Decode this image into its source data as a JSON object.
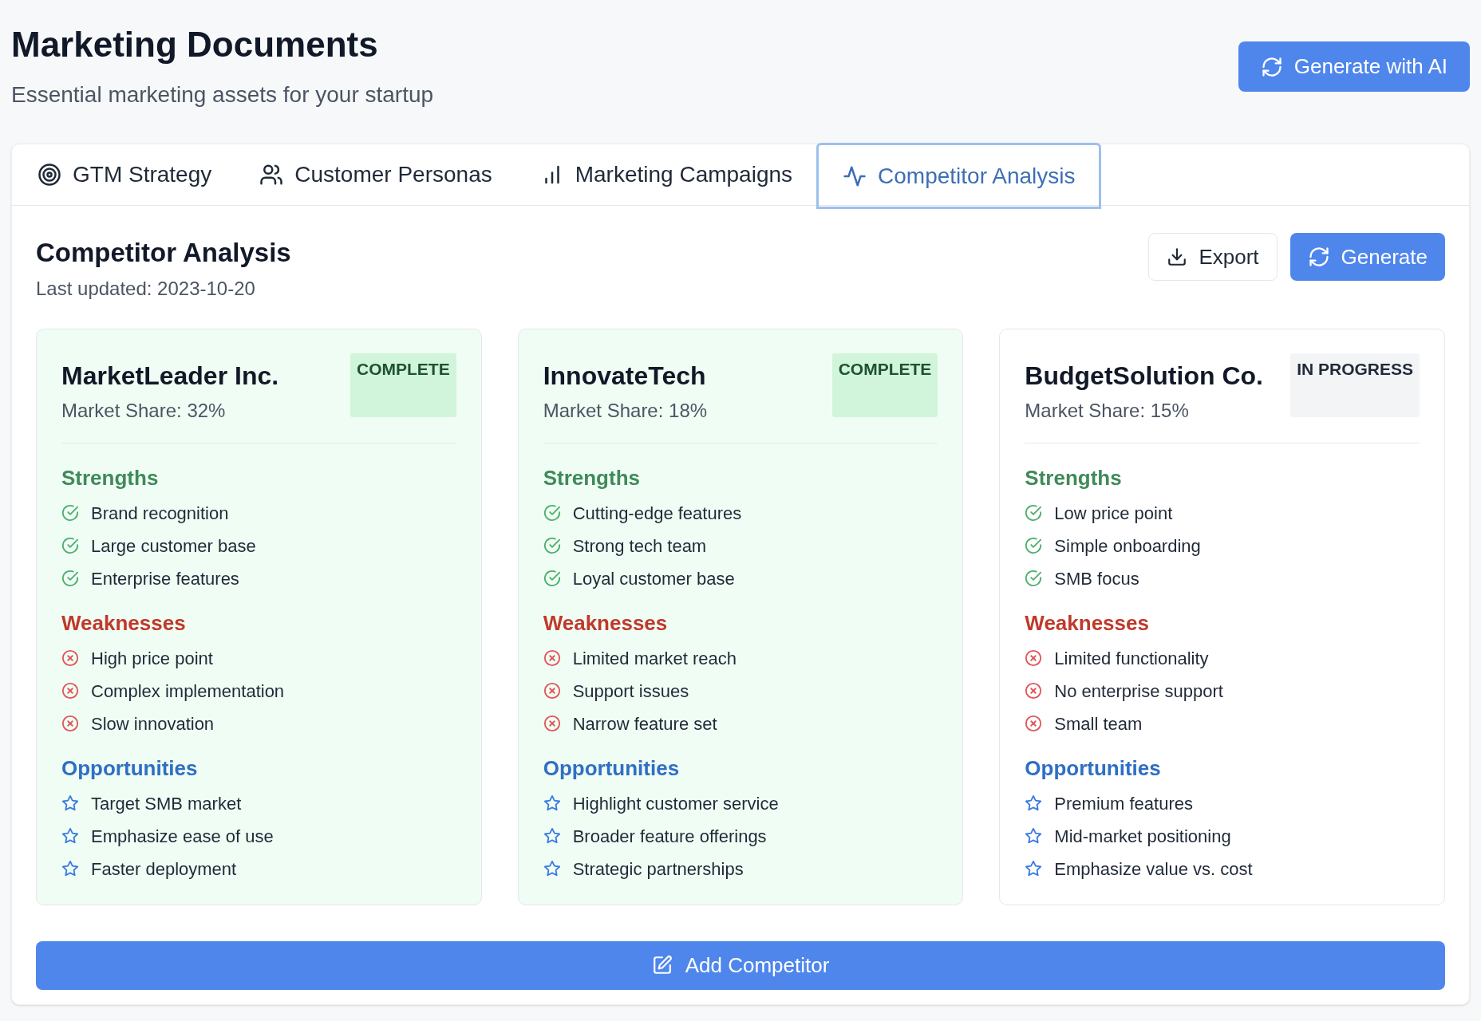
{
  "header": {
    "title": "Marketing Documents",
    "subtitle": "Essential marketing assets for your startup",
    "action": "Generate with AI"
  },
  "tabs": [
    {
      "label": "GTM Strategy",
      "selected": false
    },
    {
      "label": "Customer Personas",
      "selected": false
    },
    {
      "label": "Marketing Campaigns",
      "selected": false
    },
    {
      "label": "Competitor Analysis",
      "selected": true
    }
  ],
  "section": {
    "title": "Competitor Analysis",
    "updated": "Last updated: 2023-10-20",
    "buttons": [
      {
        "label": "Export",
        "kind": "outline"
      },
      {
        "label": "Generate",
        "kind": "primary"
      }
    ]
  },
  "competitors": [
    {
      "name": "MarketLeader Inc.",
      "share": "Market Share: 32%",
      "status": "COMPLETE",
      "kind": "complete",
      "groups": [
        {
          "title": "Strengths",
          "kind": "strength",
          "items": [
            "Brand recognition",
            "Large customer base",
            "Enterprise features"
          ]
        },
        {
          "title": "Weaknesses",
          "kind": "weakness",
          "items": [
            "High price point",
            "Complex implementation",
            "Slow innovation"
          ]
        },
        {
          "title": "Opportunities",
          "kind": "opportunity",
          "items": [
            "Target SMB market",
            "Emphasize ease of use",
            "Faster deployment"
          ]
        }
      ]
    },
    {
      "name": "InnovateTech",
      "share": "Market Share: 18%",
      "status": "COMPLETE",
      "kind": "complete",
      "groups": [
        {
          "title": "Strengths",
          "kind": "strength",
          "items": [
            "Cutting-edge features",
            "Strong tech team",
            "Loyal customer base"
          ]
        },
        {
          "title": "Weaknesses",
          "kind": "weakness",
          "items": [
            "Limited market reach",
            "Support issues",
            "Narrow feature set"
          ]
        },
        {
          "title": "Opportunities",
          "kind": "opportunity",
          "items": [
            "Highlight customer service",
            "Broader feature offerings",
            "Strategic partnerships"
          ]
        }
      ]
    },
    {
      "name": "BudgetSolution Co.",
      "share": "Market Share: 15%",
      "status": "IN PROGRESS",
      "kind": "in_progress",
      "groups": [
        {
          "title": "Strengths",
          "kind": "strength",
          "items": [
            "Low price point",
            "Simple onboarding",
            "SMB focus"
          ]
        },
        {
          "title": "Weaknesses",
          "kind": "weakness",
          "items": [
            "Limited functionality",
            "No enterprise support",
            "Small team"
          ]
        },
        {
          "title": "Opportunities",
          "kind": "opportunity",
          "items": [
            "Premium features",
            "Mid-market positioning",
            "Emphasize value vs. cost"
          ]
        }
      ]
    }
  ],
  "add_button": "Add Competitor"
}
